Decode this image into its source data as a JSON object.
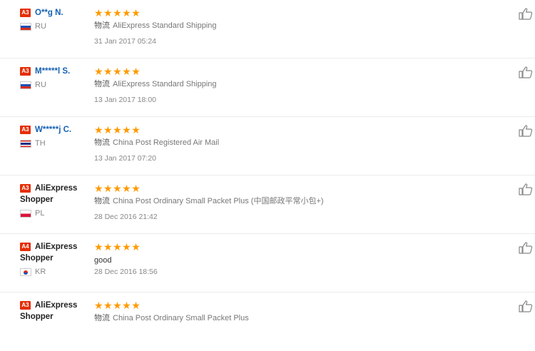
{
  "reviews": [
    {
      "level": "A3",
      "name": "O**g N.",
      "name_style": "blue",
      "flag": "ru",
      "country": "RU",
      "stars": "★★★★★",
      "shipping_label": "物流",
      "shipping": "AliExpress Standard Shipping",
      "comment": "",
      "date": "31 Jan 2017 05:24"
    },
    {
      "level": "A3",
      "name": "M*****l S.",
      "name_style": "blue",
      "flag": "ru",
      "country": "RU",
      "stars": "★★★★★",
      "shipping_label": "物流",
      "shipping": "AliExpress Standard Shipping",
      "comment": "",
      "date": "13 Jan 2017 18:00"
    },
    {
      "level": "A3",
      "name": "W*****j C.",
      "name_style": "blue",
      "flag": "th",
      "country": "TH",
      "stars": "★★★★★",
      "shipping_label": "物流",
      "shipping": "China Post Registered Air Mail",
      "comment": "",
      "date": "13 Jan 2017 07:20"
    },
    {
      "level": "A3",
      "name": "AliExpress Shopper",
      "name_style": "dark",
      "flag": "pl",
      "country": "PL",
      "stars": "★★★★★",
      "shipping_label": "物流",
      "shipping": "China Post Ordinary Small Packet Plus (中国邮政平常小包+)",
      "comment": "",
      "date": "28 Dec 2016 21:42"
    },
    {
      "level": "A4",
      "name": "AliExpress Shopper",
      "name_style": "dark",
      "flag": "kr",
      "country": "KR",
      "stars": "★★★★★",
      "shipping_label": "",
      "shipping": "",
      "comment": "good",
      "date": "28 Dec 2016 18:56"
    },
    {
      "level": "A3",
      "name": "AliExpress Shopper",
      "name_style": "dark",
      "flag": "",
      "country": "",
      "stars": "★★★★★",
      "shipping_label": "物流",
      "shipping": "China Post Ordinary Small Packet Plus",
      "comment": "",
      "date": ""
    }
  ],
  "icons": {
    "helpful": "thumbs-up-icon"
  },
  "colors": {
    "badge": "#e62e04",
    "stars": "#ff9a00",
    "name": "#1561b3"
  }
}
